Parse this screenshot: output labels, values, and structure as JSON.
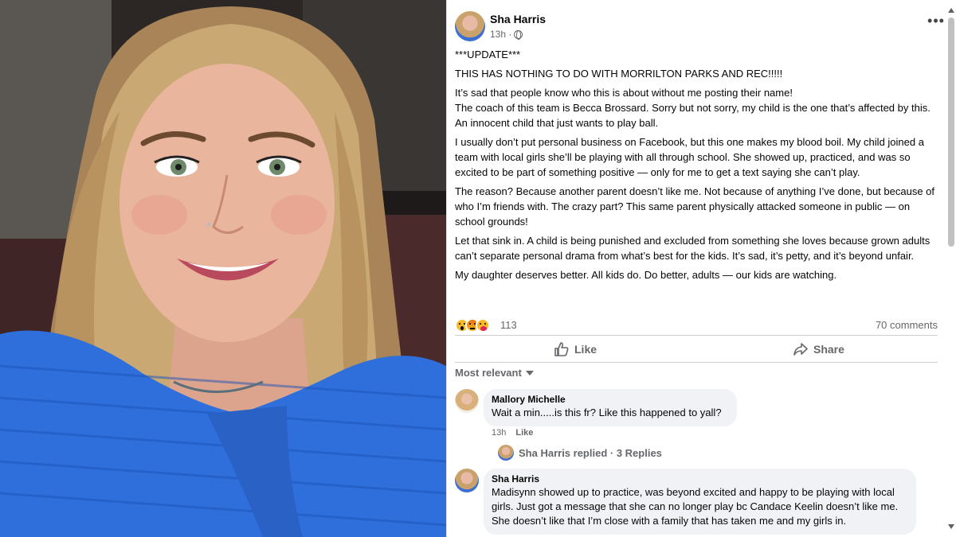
{
  "photo": {
    "description_icon": "selfie-photo",
    "colors": {
      "shirt": "#2f6fdb",
      "hair": "#b89465",
      "skin": "#e9b59c",
      "background": "#2b2522"
    }
  },
  "post": {
    "author": "Sha Harris",
    "time": "13h ·",
    "privacy_icon": "globe-icon",
    "more_label": "•••",
    "paragraphs": [
      "***UPDATE***",
      "THIS HAS NOTHING TO DO WITH MORRILTON PARKS AND REC!!!!!",
      "It’s sad that people know who this is about without me posting their name!\nThe coach of this team is Becca Brossard. Sorry but not sorry, my child is the one that’s affected by this. An innocent child that just wants to play ball.",
      "I usually don’t put personal business on Facebook, but this one makes my blood boil. My child joined a team with local girls she’ll be playing with all through school. She showed up, practiced, and was so excited to be part of something positive — only for me to get a text saying she can’t play.",
      "The reason? Because another parent doesn’t like me. Not because of anything I’ve done, but because of who I’m friends with. The crazy part? This same parent physically attacked someone in public — on school grounds!",
      "Let that sink in. A child is being punished and excluded from something she loves because grown adults can’t separate personal drama from what’s best for the kids. It’s sad, it’s petty, and it’s beyond unfair.",
      "My daughter deserves better. All kids do. Do better, adults — our kids are watching."
    ],
    "reactions": {
      "count": "113",
      "icons": [
        "wow-icon",
        "angry-icon",
        "care-icon"
      ]
    },
    "comments_count": "70 comments",
    "actions": {
      "like": "Like",
      "share": "Share"
    },
    "sort_label": "Most relevant"
  },
  "comments": [
    {
      "name": "Mallory Michelle",
      "text": "Wait a min.....is this fr? Like this happened to yall?",
      "time": "13h",
      "like": "Like",
      "replied": "Sha Harris replied · 3 Replies"
    },
    {
      "name": "Sha Harris",
      "text": "Madisynn showed up to practice, was beyond excited and happy to be playing with local girls. Just got a message that she can no longer play bc Candace Keelin doesn’t like me. She doesn’t like that I’m close with a family that has taken me and my girls in."
    }
  ],
  "colors": {
    "secondary_text": "#65676b",
    "bubble": "#f0f2f5",
    "divider": "#ced0d4"
  }
}
